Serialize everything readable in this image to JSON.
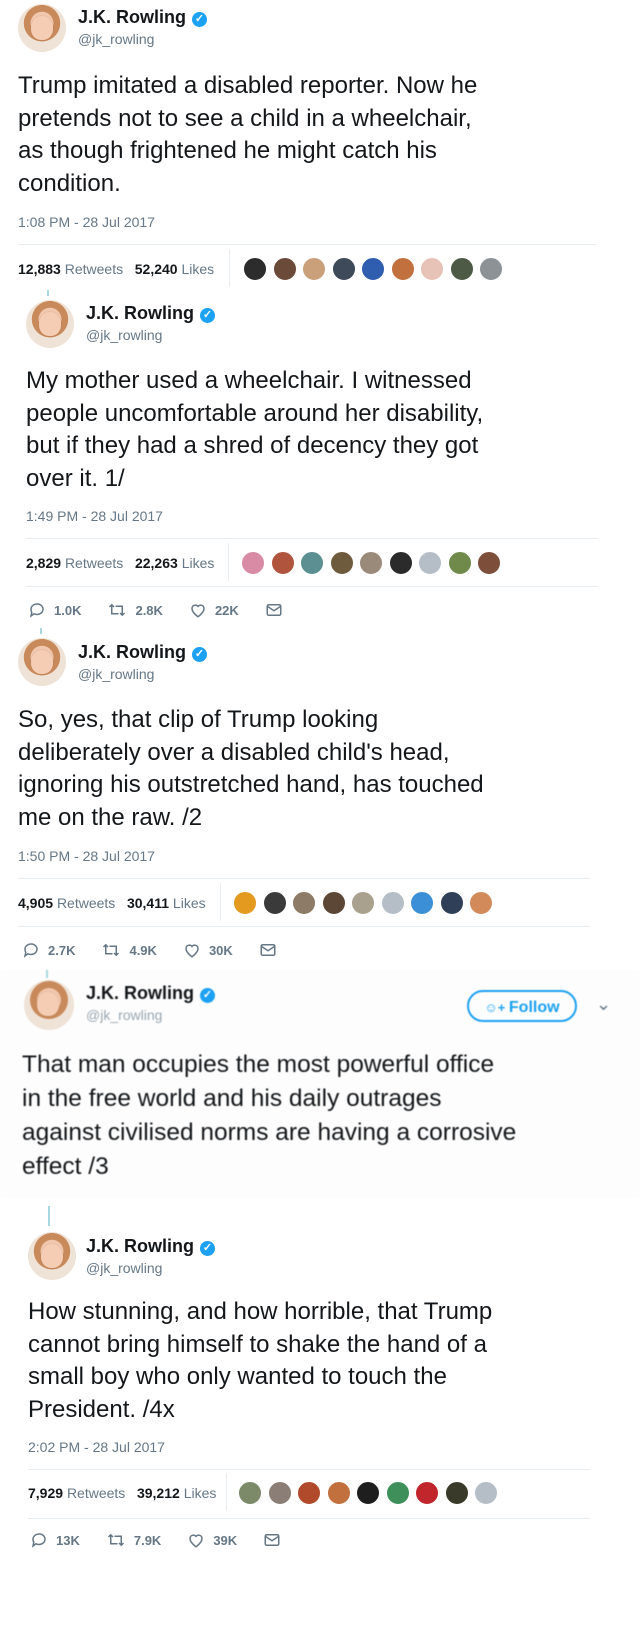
{
  "tweets": [
    {
      "author": {
        "name": "J.K. Rowling",
        "handle": "@jk_rowling"
      },
      "text": "Trump imitated a disabled reporter. Now he\npretends not to see a child in a wheelchair,\nas though frightened he might catch his\ncondition.",
      "timestamp": "1:08 PM - 28 Jul 2017",
      "retweets": "12,883",
      "retweets_label": "Retweets",
      "likes": "52,240",
      "likes_label": "Likes"
    },
    {
      "author": {
        "name": "J.K. Rowling",
        "handle": "@jk_rowling"
      },
      "text": "My mother used a wheelchair. I witnessed\npeople uncomfortable around her disability,\nbut if they had a shred of decency they got\nover it. 1/",
      "timestamp": "1:49 PM - 28 Jul 2017",
      "retweets": "2,829",
      "retweets_label": "Retweets",
      "likes": "22,263",
      "likes_label": "Likes",
      "actions": {
        "replies": "1.0K",
        "retweets": "2.8K",
        "likes": "22K"
      }
    },
    {
      "author": {
        "name": "J.K. Rowling",
        "handle": "@jk_rowling"
      },
      "text": "So, yes, that clip of Trump looking\ndeliberately over a disabled child's head,\nignoring his outstretched hand, has touched\nme on the raw. /2",
      "timestamp": "1:50 PM - 28 Jul 2017",
      "retweets": "4,905",
      "retweets_label": "Retweets",
      "likes": "30,411",
      "likes_label": "Likes",
      "actions": {
        "replies": "2.7K",
        "retweets": "4.9K",
        "likes": "30K"
      }
    },
    {
      "author": {
        "name": "J.K. Rowling",
        "handle": "@jk_rowling"
      },
      "follow_label": "Follow",
      "text": "That man occupies the most powerful office\nin the free world and his daily outrages\nagainst civilised norms are having a corrosive\neffect /3"
    },
    {
      "author": {
        "name": "J.K. Rowling",
        "handle": "@jk_rowling"
      },
      "text": "How stunning, and how horrible, that Trump\ncannot bring himself to shake the hand of a\nsmall boy who only wanted to touch the\nPresident. /4x",
      "timestamp": "2:02 PM - 28 Jul 2017",
      "retweets": "7,929",
      "retweets_label": "Retweets",
      "likes": "39,212",
      "likes_label": "Likes",
      "actions": {
        "replies": "13K",
        "retweets": "7.9K",
        "likes": "39K"
      }
    }
  ],
  "icons": {
    "verified": "verified-badge-icon",
    "reply": "reply-icon",
    "retweet": "retweet-icon",
    "like": "heart-icon",
    "message": "envelope-icon",
    "follow": "add-person-icon",
    "more": "chevron-down-icon"
  },
  "colors": {
    "accent": "#1da1f2",
    "text": "#14171a",
    "secondary": "#657786",
    "divider": "#e6ecf0",
    "thread": "#a7d6dd"
  }
}
